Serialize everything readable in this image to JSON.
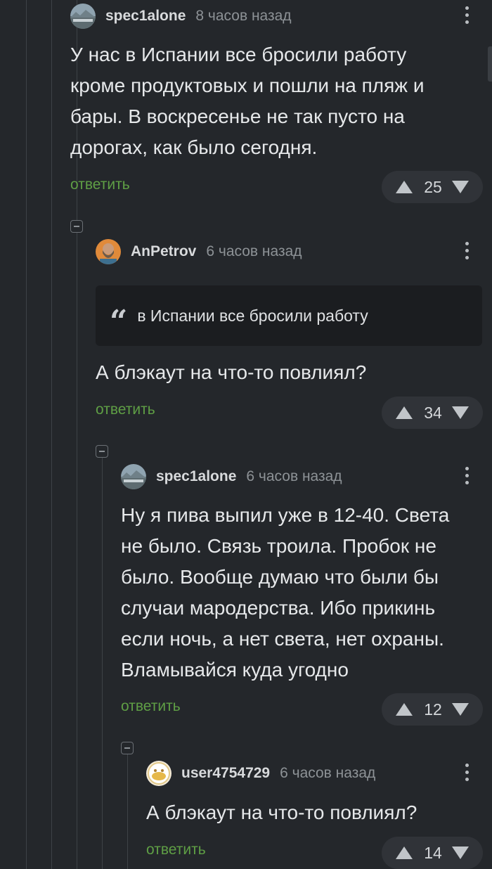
{
  "colors": {
    "background": "#24272b",
    "reply_link": "#5f9f45",
    "vote_pill": "#303338",
    "quote_bg": "#1b1d20"
  },
  "comments": [
    {
      "author": "spec1alone",
      "time": "8 часов назад",
      "text": "У нас в Испании все бросили работу кроме продуктовых и пошли на пляж и бары. В воскресенье не так пусто на дорогах, как было сегодня.",
      "reply": "ответить",
      "score": "25",
      "avatar_icon": "landscape-avatar-icon"
    },
    {
      "author": "AnPetrov",
      "time": "6 часов назад",
      "quote": "в Испании все бросили работу",
      "text": "А блэкаут на что-то повлиял?",
      "reply": "ответить",
      "score": "34",
      "avatar_icon": "bearded-man-avatar-icon"
    },
    {
      "author": "spec1alone",
      "time": "6 часов назад",
      "text": "Ну я пива выпил уже в 12-40. Света не было. Связь троила. Пробок не было. Вообще думаю что были бы случаи мародерства. Ибо прикинь если ночь, а нет света, нет охраны. Вламывайся куда угодно",
      "reply": "ответить",
      "score": "12",
      "avatar_icon": "landscape-avatar-icon"
    },
    {
      "author": "user4754729",
      "time": "6 часов назад",
      "text": "А блэкаут на что-то повлиял?",
      "reply": "ответить",
      "score": "14",
      "avatar_icon": "cartoon-avatar-icon"
    }
  ]
}
